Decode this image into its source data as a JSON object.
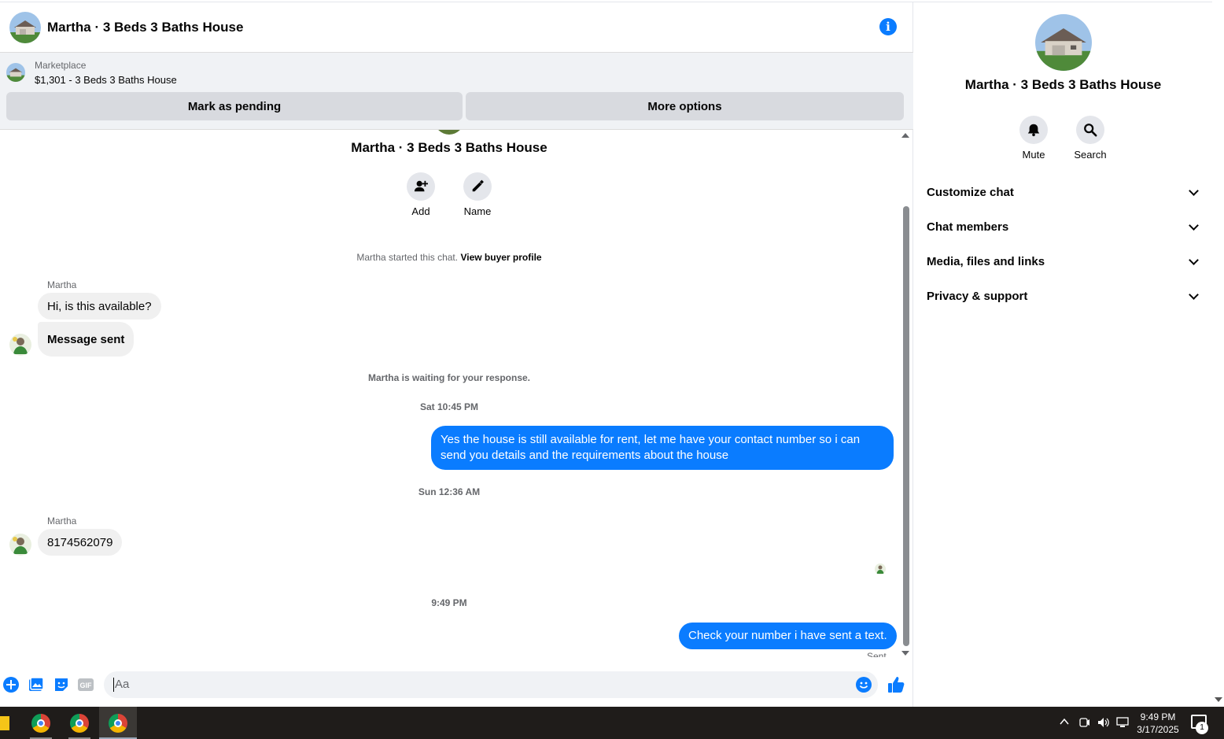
{
  "header": {
    "title": "Martha · 3 Beds 3 Baths House"
  },
  "marketplace": {
    "label": "Marketplace",
    "item": "$1,301 - 3 Beds 3 Baths House",
    "mark_pending": "Mark as pending",
    "more_options": "More options"
  },
  "thread": {
    "profile_name": "Martha · 3 Beds 3 Baths House",
    "actions": [
      {
        "label": "Add"
      },
      {
        "label": "Name"
      }
    ],
    "started_text": "Martha started this chat.",
    "view_profile": "View buyer profile",
    "sender_1": "Martha",
    "msg_1": "Hi, is this available?",
    "msg_2": "Message sent",
    "waiting": "Martha is waiting for your response.",
    "time_1": "Sat 10:45 PM",
    "out_1": "Yes the house is still available for rent, let me have your contact number so i can send you details and the requirements about the house",
    "time_2": "Sun 12:36 AM",
    "sender_2": "Martha",
    "msg_3": "8174562079",
    "time_3": "9:49 PM",
    "out_2": "Check your number i have sent a text.",
    "status": "Sent"
  },
  "composer": {
    "placeholder": "Aa"
  },
  "panel": {
    "title": "Martha · 3 Beds 3 Baths House",
    "actions": [
      {
        "label": "Mute",
        "icon": "bell-icon"
      },
      {
        "label": "Search",
        "icon": "search-icon"
      }
    ],
    "sections": [
      {
        "label": "Customize chat"
      },
      {
        "label": "Chat members"
      },
      {
        "label": "Media, files and links"
      },
      {
        "label": "Privacy & support"
      }
    ]
  },
  "taskbar": {
    "time": "9:49 PM",
    "date": "3/17/2025",
    "notifications": "1"
  },
  "colors": {
    "accent": "#0a7cff",
    "bubble_in": "#f0f0f0",
    "panel_bg": "#f0f2f5"
  }
}
